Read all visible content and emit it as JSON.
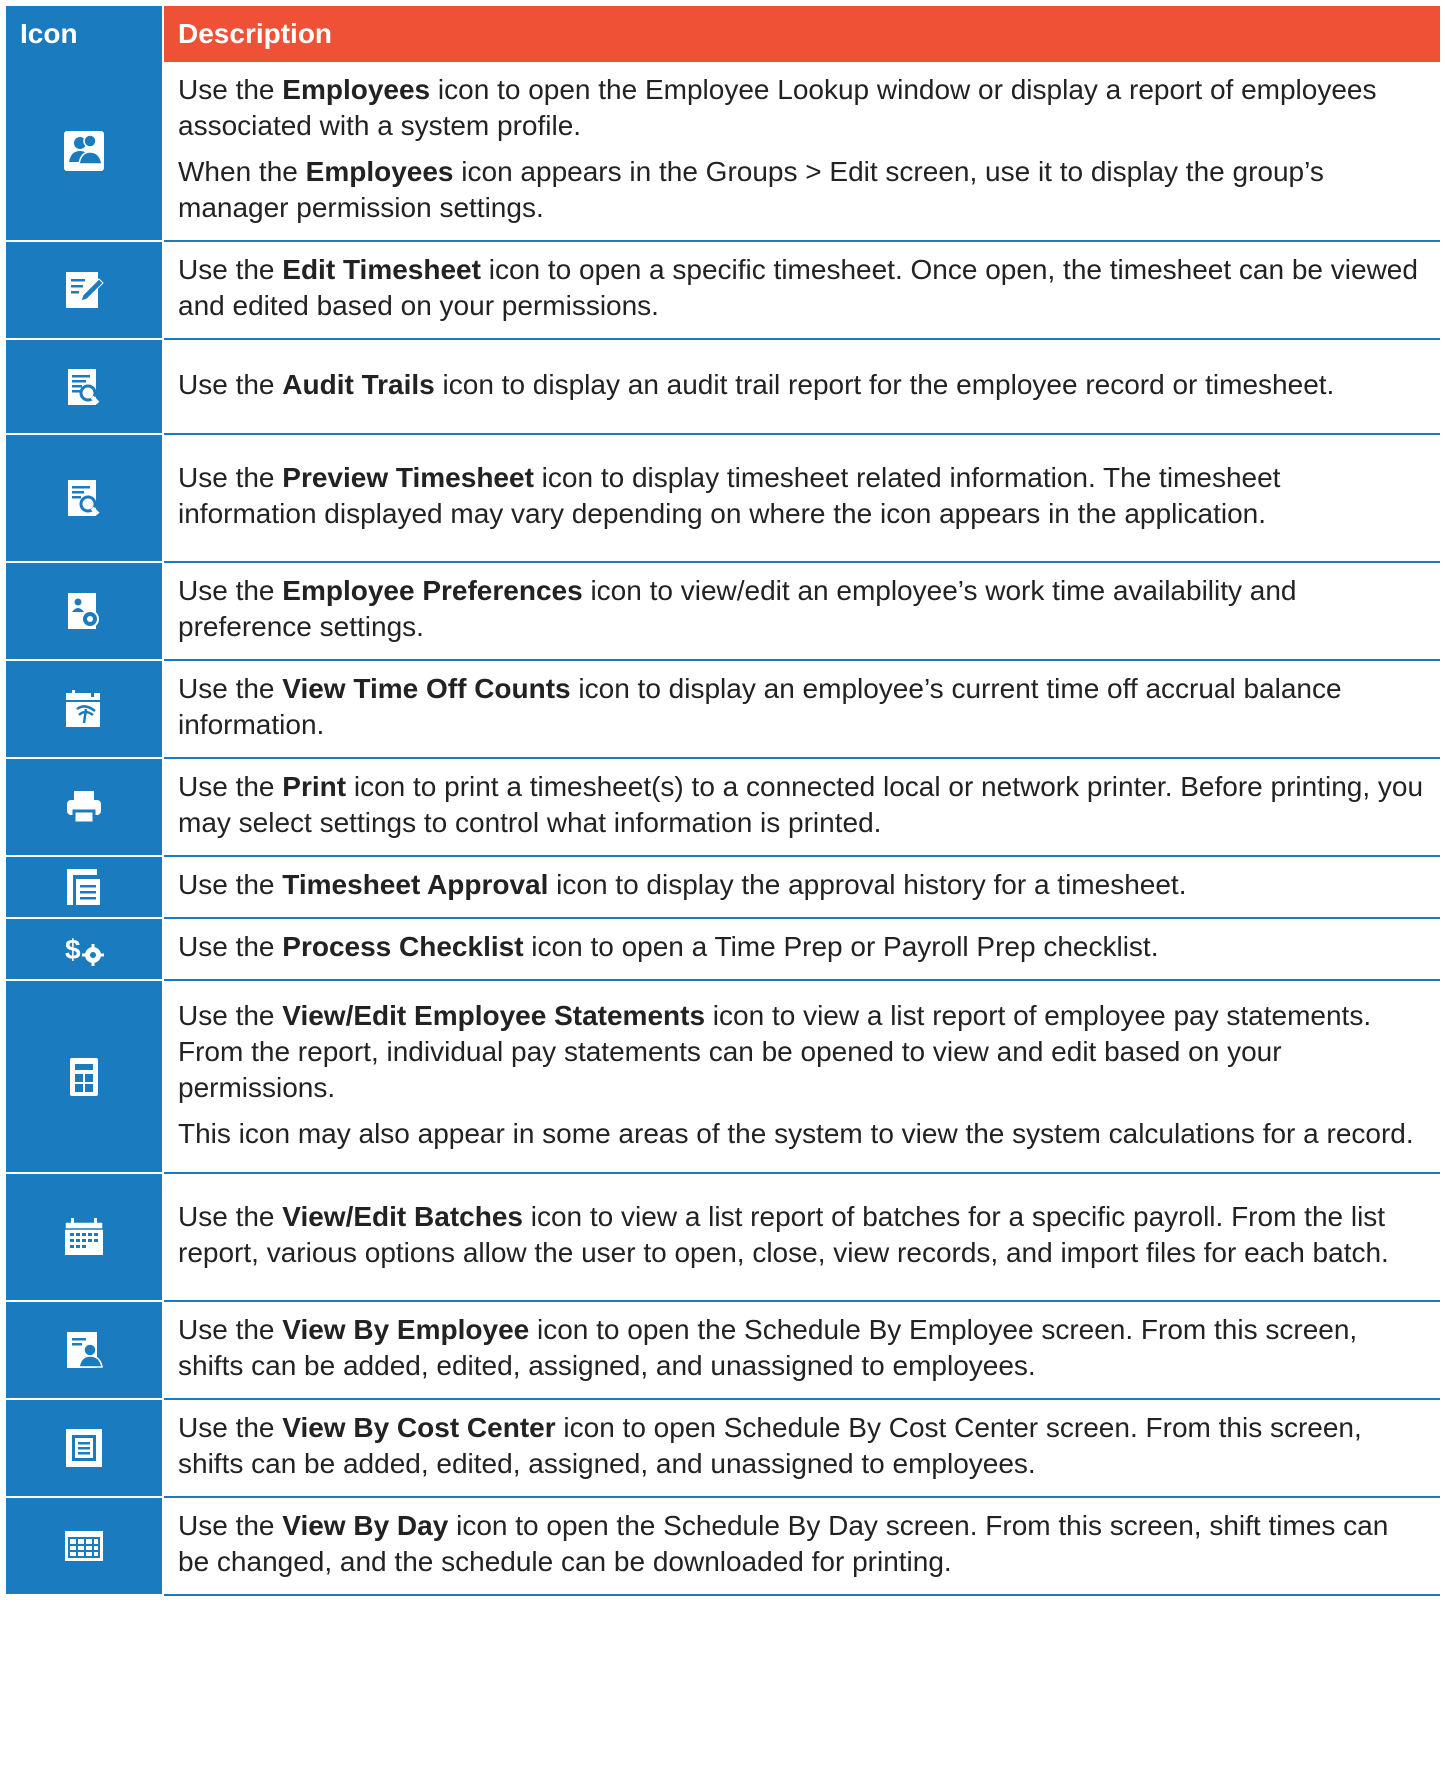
{
  "header": {
    "icon_col": "Icon",
    "description_col": "Description"
  },
  "rows": [
    {
      "icon": "employees-icon",
      "h": 172,
      "paras": [
        {
          "pre": "Use the ",
          "bold": "Employees",
          "post": " icon to open the Employee Lookup window or display a report of employees associated with a system profile."
        },
        {
          "pre": "When the ",
          "bold": "Employees",
          "post": " icon appears in the Groups > Edit screen, use it to display the group’s manager permission settings."
        }
      ]
    },
    {
      "icon": "edit-timesheet-icon",
      "h": 96,
      "paras": [
        {
          "pre": "Use the ",
          "bold": "Edit Timesheet",
          "post": " icon to open a specific timesheet. Once open, the timesheet can be viewed and edited based on your permissions."
        }
      ]
    },
    {
      "icon": "audit-trails-icon",
      "h": 95,
      "paras": [
        {
          "pre": "Use the ",
          "bold": "Audit Trails",
          "post": " icon to display an audit trail report for the employee record or timesheet."
        }
      ]
    },
    {
      "icon": "preview-timesheet-icon",
      "h": 128,
      "paras": [
        {
          "pre": "Use the ",
          "bold": "Preview Timesheet",
          "post": " icon to display timesheet related information. The timesheet information displayed may vary depending on where the icon appears in the application."
        }
      ]
    },
    {
      "icon": "employee-preferences-icon",
      "h": 95,
      "paras": [
        {
          "pre": "Use the ",
          "bold": "Employee Preferences",
          "post": " icon to view/edit an employee’s work time availability and preference settings."
        }
      ]
    },
    {
      "icon": "time-off-counts-icon",
      "h": 95,
      "paras": [
        {
          "pre": "Use the ",
          "bold": "View Time Off Counts",
          "post": " icon to display an employee’s current time off accrual balance information."
        }
      ]
    },
    {
      "icon": "print-icon",
      "h": 95,
      "paras": [
        {
          "pre": "Use the ",
          "bold": "Print",
          "post": " icon to print a timesheet(s) to a connected local or network printer. Before printing, you may select settings to control what information is printed."
        }
      ]
    },
    {
      "icon": "timesheet-approval-icon",
      "h": 61,
      "paras": [
        {
          "pre": "Use the ",
          "bold": "Timesheet Approval",
          "post": " icon to display the approval history for a timesheet."
        }
      ]
    },
    {
      "icon": "process-checklist-icon",
      "h": 61,
      "paras": [
        {
          "pre": "Use the ",
          "bold": "Process Checklist",
          "post": " icon to open a Time Prep or Payroll Prep checklist."
        }
      ]
    },
    {
      "icon": "calculator-icon",
      "h": 193,
      "paras": [
        {
          "pre": "Use the ",
          "bold": "View/Edit Employee Statements",
          "post": " icon to view a list report of employee pay statements. From the report, individual pay statements can be opened to view and edit based on your permissions."
        },
        {
          "pre": "",
          "bold": "",
          "post": "This icon may also appear in some areas of the system to view the system calculations for a record."
        }
      ]
    },
    {
      "icon": "batches-calendar-icon",
      "h": 128,
      "paras": [
        {
          "pre": "Use the ",
          "bold": "View/Edit Batches",
          "post": " icon to view a list report of batches for a specific payroll. From the list report, various options allow the user to open, close, view records, and import files for each batch."
        }
      ]
    },
    {
      "icon": "view-by-employee-icon",
      "h": 95,
      "paras": [
        {
          "pre": "Use the ",
          "bold": "View By Employee",
          "post": " icon to open the Schedule By Employee screen. From this screen, shifts can be added, edited, assigned, and unassigned to employees."
        }
      ]
    },
    {
      "icon": "view-by-cost-center-icon",
      "h": 95,
      "paras": [
        {
          "pre": "Use the ",
          "bold": "View By Cost Center",
          "post": " icon to open Schedule By Cost Center screen. From this screen, shifts can be added, edited, assigned, and unassigned to employees."
        }
      ]
    },
    {
      "icon": "view-by-day-icon",
      "h": 96,
      "paras": [
        {
          "pre": "Use the ",
          "bold": "View By Day",
          "post": " icon to open the Schedule By Day screen. From this screen, shift times can be changed, and the schedule can be downloaded for printing."
        }
      ]
    }
  ]
}
